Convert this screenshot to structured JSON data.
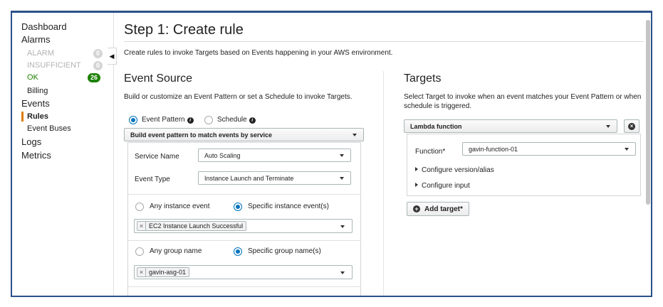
{
  "sidebar": {
    "dashboard": "Dashboard",
    "alarms": "Alarms",
    "alarm": {
      "label": "ALARM",
      "count": "0"
    },
    "insufficient": {
      "label": "INSUFFICIENT",
      "count": "0"
    },
    "ok": {
      "label": "OK",
      "count": "26"
    },
    "billing": "Billing",
    "events": "Events",
    "rules": "Rules",
    "event_buses": "Event Buses",
    "logs": "Logs",
    "metrics": "Metrics"
  },
  "page": {
    "title": "Step 1: Create rule",
    "subtitle": "Create rules to invoke Targets based on Events happening in your AWS environment."
  },
  "event_source": {
    "heading": "Event Source",
    "description": "Build or customize an Event Pattern or set a Schedule to invoke Targets.",
    "option_pattern": "Event Pattern",
    "option_schedule": "Schedule",
    "pattern_select": "Build event pattern to match events by service",
    "service_name_label": "Service Name",
    "service_name_value": "Auto Scaling",
    "event_type_label": "Event Type",
    "event_type_value": "Instance Launch and Terminate",
    "any_instance": "Any instance event",
    "specific_instance": "Specific instance event(s)",
    "instance_token": "EC2 Instance Launch Successful",
    "any_group": "Any group name",
    "specific_group": "Specific group name(s)",
    "group_token": "gavin-asg-01"
  },
  "targets": {
    "heading": "Targets",
    "description": "Select Target to invoke when an event matches your Event Pattern or when schedule is triggered.",
    "target_type": "Lambda function",
    "function_label": "Function*",
    "function_value": "gavin-function-01",
    "configure_version": "Configure version/alias",
    "configure_input": "Configure input",
    "add_target": "Add target*"
  },
  "colors": {
    "accent": "#0073bb",
    "ok_green": "#1d8102",
    "active_orange": "#e07a00",
    "frame_border": "#2b4f8a"
  }
}
